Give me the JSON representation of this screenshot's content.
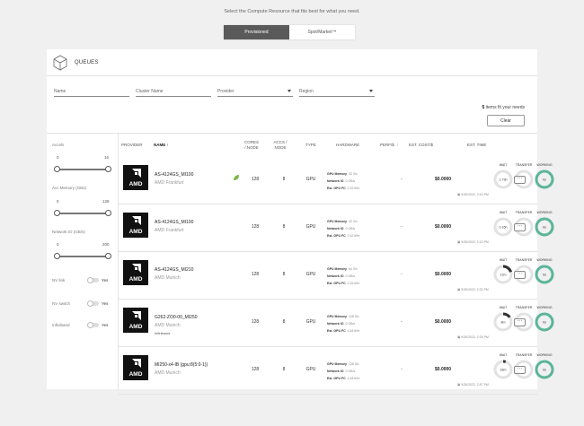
{
  "intro": "Select the Compute Resource that fits best for what you need.",
  "mode_toggle": {
    "active": "Provisioned",
    "inactive": "Spot/Market™"
  },
  "queues_title": "QUEUES",
  "filters": {
    "name": "Name",
    "cluster": "Cluster Name",
    "provider": "Provider",
    "region": "Region"
  },
  "fit": {
    "count": "5",
    "text": "items fit your needs"
  },
  "clear_label": "Clear",
  "sidebar": {
    "accels": {
      "label": "Accels",
      "min": "0",
      "max": "16"
    },
    "acc_memory": {
      "label": "Acc Memory (GBs)",
      "min": "0",
      "max": "128"
    },
    "network": {
      "label": "Network IO (GB/s)",
      "min": "0",
      "max": "200"
    },
    "toggles": [
      {
        "label": "NV link",
        "value": "Yes"
      },
      {
        "label": "NV switch",
        "value": "Yes"
      },
      {
        "label": "Infiniband",
        "value": "Yes"
      }
    ]
  },
  "columns": {
    "provider": "PROVIDER",
    "name": "NAME",
    "cores_1": "CORES",
    "cores_2": "/ NODE",
    "accs_1": "ACCS /",
    "accs_2": "NODE",
    "type": "TYPE",
    "hardware": "HARDWARE",
    "perf": "PERF/$",
    "cost": "EST. COST/$",
    "time": "EST. TIME"
  },
  "hw_labels": {
    "mem": "GPU Memory",
    "net": "Network IO",
    "perf": "Est. GPU FC"
  },
  "time_labels": {
    "wait": "WAIT",
    "transfer": "TRANSFER",
    "working": "WORKING"
  },
  "rows": [
    {
      "logo": "AMD",
      "name": "AS-4124GS_MI100",
      "location": "AMD Frankfurt",
      "badge": "",
      "leaf": true,
      "cores": "128",
      "accs": "8",
      "type": "GPU",
      "mem": "32 Gb",
      "net": "0 GB/s",
      "fc": "2.32 tf/hr",
      "perf": "-",
      "cost": "$0.0000",
      "wait": "1.73h",
      "transfer": "0s",
      "working": "0s",
      "wait_fill": 0.0,
      "date": "9/30/2022, 2:10 PM"
    },
    {
      "logo": "AMD",
      "name": "AS-4124GS_MI100",
      "location": "AMD Frankfurt",
      "badge": "",
      "leaf": false,
      "cores": "128",
      "accs": "8",
      "type": "GPU",
      "mem": "32 Gb",
      "net": "0 GB/s",
      "fc": "2.32 tf/hr",
      "perf": "-",
      "cost": "$0.0000",
      "wait": "0.16h",
      "transfer": "0s",
      "working": "0s",
      "wait_fill": 0.0,
      "date": "9/30/2022, 2:10 PM"
    },
    {
      "logo": "AMD",
      "name": "AS-4124GS_MI210",
      "location": "AMD Munich",
      "badge": "",
      "leaf": false,
      "cores": "128",
      "accs": "8",
      "type": "GPU",
      "mem": "64 Gb",
      "net": "0 GB/s",
      "fc": "2.32 tf/hr",
      "perf": "-",
      "cost": "$0.0000",
      "wait": "12m",
      "transfer": "0s",
      "working": "0s",
      "wait_fill": 0.2,
      "date": "9/30/2022, 2:32 PM"
    },
    {
      "logo": "AMD",
      "name": "G262-ZO0-00_MI250",
      "location": "AMD Munich",
      "badge": "Infiniband",
      "leaf": false,
      "cores": "128",
      "accs": "8",
      "type": "GPU",
      "mem": "128 Gb",
      "net": "0 GB/s",
      "fc": "4.48 tf/hr",
      "perf": "-",
      "cost": "$0.0000",
      "wait": "8m",
      "transfer": "0s",
      "working": "0s",
      "wait_fill": 0.15,
      "date": "9/30/2022, 2:25 PM"
    },
    {
      "logo": "AMD",
      "name": "MI250-x4-IB (gpu:8(5:0-1))",
      "location": "AMD Munich",
      "badge": "",
      "leaf": false,
      "cores": "128",
      "accs": "8",
      "type": "GPU",
      "mem": "128 Gb",
      "net": "0 GB/s",
      "fc": "4.48 tf/hr",
      "perf": "-",
      "cost": "$0.0000",
      "wait": "33m",
      "transfer": "0s",
      "working": "0s",
      "wait_fill": 0.05,
      "date": "9/30/2022, 2:57 PM"
    }
  ]
}
